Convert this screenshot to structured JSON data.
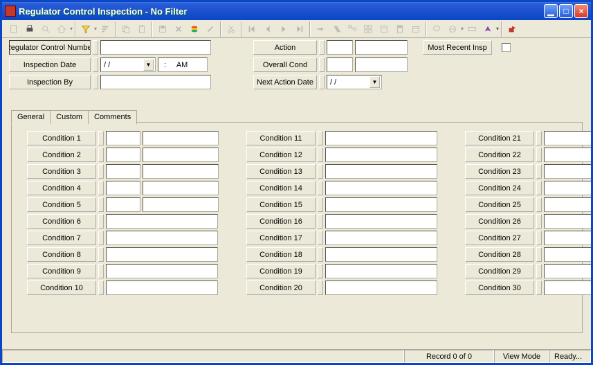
{
  "window": {
    "title": "Regulator Control Inspection - No Filter"
  },
  "winbtns": {
    "min": "▁",
    "max": "□",
    "close": "×"
  },
  "header": {
    "reg_ctrl_label": "Regulator Control Number",
    "insp_date_label": "Inspection Date",
    "insp_by_label": "Inspection By",
    "action_label": "Action",
    "overall_cond_label": "Overall Cond",
    "next_action_date_label": "Next Action Date",
    "most_recent_insp_label": "Most Recent Insp",
    "reg_ctrl_value": "",
    "insp_date_value": "  /  /",
    "insp_time_value": "  :     AM",
    "insp_by_value": "",
    "action_code": "",
    "action_text": "",
    "overall_code": "",
    "overall_text": "",
    "next_action_date_value": "  /  /",
    "most_recent_insp_checked": false
  },
  "tabs": {
    "general": "General",
    "custom": "Custom",
    "comments": "Comments"
  },
  "conditions_a": [
    {
      "label": "Condition 1",
      "v": "",
      "v2": ""
    },
    {
      "label": "Condition 2",
      "v": "",
      "v2": ""
    },
    {
      "label": "Condition 3",
      "v": "",
      "v2": ""
    },
    {
      "label": "Condition 4",
      "v": "",
      "v2": ""
    },
    {
      "label": "Condition 5",
      "v": "",
      "v2": ""
    },
    {
      "label": "Condition 6",
      "v": ""
    },
    {
      "label": "Condition 7",
      "v": ""
    },
    {
      "label": "Condition 8",
      "v": ""
    },
    {
      "label": "Condition 9",
      "v": ""
    },
    {
      "label": "Condition 10",
      "v": ""
    }
  ],
  "conditions_b": [
    {
      "label": "Condition 11",
      "v": ""
    },
    {
      "label": "Condition 12",
      "v": ""
    },
    {
      "label": "Condition 13",
      "v": ""
    },
    {
      "label": "Condition 14",
      "v": ""
    },
    {
      "label": "Condition 15",
      "v": ""
    },
    {
      "label": "Condition 16",
      "v": ""
    },
    {
      "label": "Condition 17",
      "v": ""
    },
    {
      "label": "Condition 18",
      "v": ""
    },
    {
      "label": "Condition 19",
      "v": ""
    },
    {
      "label": "Condition 20",
      "v": ""
    }
  ],
  "conditions_c": [
    {
      "label": "Condition 21",
      "v": "",
      "chk": false
    },
    {
      "label": "Condition 22",
      "v": "",
      "chk": false
    },
    {
      "label": "Condition 23",
      "v": "",
      "chk": false
    },
    {
      "label": "Condition 24",
      "v": "",
      "chk": false
    },
    {
      "label": "Condition 25",
      "v": "",
      "chk": false
    },
    {
      "label": "Condition 26",
      "v": "",
      "chk": false
    },
    {
      "label": "Condition 27",
      "v": "",
      "chk": false
    },
    {
      "label": "Condition 28",
      "v": "",
      "chk": false
    },
    {
      "label": "Condition 29",
      "v": "",
      "chk": false
    },
    {
      "label": "Condition 30",
      "v": "",
      "chk": false
    }
  ],
  "status": {
    "record": "Record 0 of 0",
    "mode": "View Mode",
    "ready": "Ready..."
  },
  "icons": {
    "combo_arrow": "▼"
  }
}
